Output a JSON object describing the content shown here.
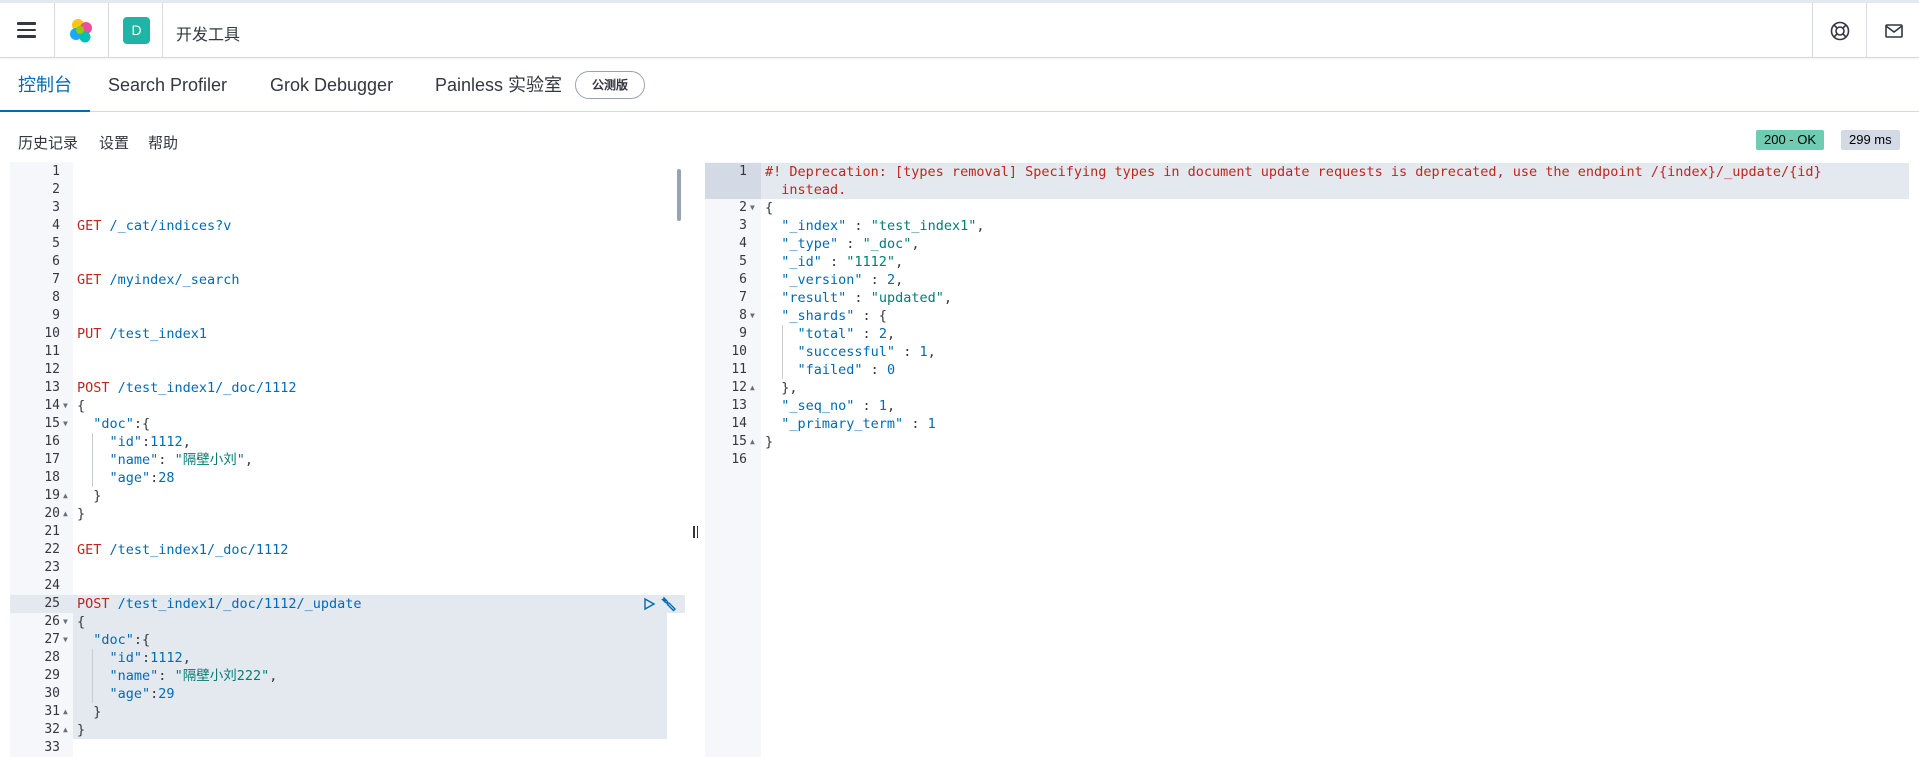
{
  "header": {
    "space_initial": "D",
    "app_title": "开发工具"
  },
  "tabs": [
    {
      "label": "控制台",
      "active": true
    },
    {
      "label": "Search Profiler",
      "active": false
    },
    {
      "label": "Grok Debugger",
      "active": false
    },
    {
      "label": "Painless 实验室",
      "active": false
    }
  ],
  "beta_badge": "公测版",
  "subnav": {
    "history": "历史记录",
    "settings": "设置",
    "help": "帮助"
  },
  "status": {
    "code": "200 - OK",
    "time": "299 ms"
  },
  "request_lines": [
    {
      "n": "1",
      "tokens": []
    },
    {
      "n": "2",
      "tokens": []
    },
    {
      "n": "3",
      "tokens": []
    },
    {
      "n": "4",
      "tokens": [
        {
          "t": "GET",
          "c": "m-get"
        },
        {
          "t": " /_cat/indices?v",
          "c": "url"
        }
      ]
    },
    {
      "n": "5",
      "tokens": []
    },
    {
      "n": "6",
      "tokens": []
    },
    {
      "n": "7",
      "tokens": [
        {
          "t": "GET",
          "c": "m-get"
        },
        {
          "t": " /myindex/_search",
          "c": "url"
        }
      ]
    },
    {
      "n": "8",
      "tokens": []
    },
    {
      "n": "9",
      "tokens": []
    },
    {
      "n": "10",
      "tokens": [
        {
          "t": "PUT",
          "c": "m-put"
        },
        {
          "t": " /test_index1",
          "c": "url"
        }
      ]
    },
    {
      "n": "11",
      "tokens": []
    },
    {
      "n": "12",
      "tokens": []
    },
    {
      "n": "13",
      "tokens": [
        {
          "t": "POST",
          "c": "m-post"
        },
        {
          "t": " /test_index1/_doc/1112",
          "c": "url"
        }
      ]
    },
    {
      "n": "14",
      "fold": "▼",
      "tokens": [
        {
          "t": "{",
          "c": ""
        }
      ]
    },
    {
      "n": "15",
      "fold": "▼",
      "tokens": [
        {
          "t": "  ",
          "c": ""
        },
        {
          "t": "\"doc\"",
          "c": "key"
        },
        {
          "t": ":{",
          "c": ""
        }
      ]
    },
    {
      "n": "16",
      "tokens": [
        {
          "t": "    ",
          "c": ""
        },
        {
          "t": "\"id\"",
          "c": "key"
        },
        {
          "t": ":",
          "c": ""
        },
        {
          "t": "1112",
          "c": "num-v"
        },
        {
          "t": ",",
          "c": ""
        }
      ]
    },
    {
      "n": "17",
      "tokens": [
        {
          "t": "    ",
          "c": ""
        },
        {
          "t": "\"name\"",
          "c": "key"
        },
        {
          "t": ": ",
          "c": ""
        },
        {
          "t": "\"隔壁小刘\"",
          "c": "str"
        },
        {
          "t": ",",
          "c": ""
        }
      ]
    },
    {
      "n": "18",
      "tokens": [
        {
          "t": "    ",
          "c": ""
        },
        {
          "t": "\"age\"",
          "c": "key"
        },
        {
          "t": ":",
          "c": ""
        },
        {
          "t": "28",
          "c": "num-v"
        }
      ]
    },
    {
      "n": "19",
      "fold": "▲",
      "tokens": [
        {
          "t": "  }",
          "c": ""
        }
      ]
    },
    {
      "n": "20",
      "fold": "▲",
      "tokens": [
        {
          "t": "}",
          "c": ""
        }
      ]
    },
    {
      "n": "21",
      "tokens": []
    },
    {
      "n": "22",
      "tokens": [
        {
          "t": "GET",
          "c": "m-get"
        },
        {
          "t": " /test_index1/_doc/1112",
          "c": "url"
        }
      ]
    },
    {
      "n": "23",
      "tokens": []
    },
    {
      "n": "24",
      "tokens": []
    },
    {
      "n": "25",
      "hl": true,
      "tokens": [
        {
          "t": "POST",
          "c": "m-post"
        },
        {
          "t": " /test_index1/_doc/1112/_update",
          "c": "url"
        }
      ]
    },
    {
      "n": "26",
      "sel": true,
      "fold": "▼",
      "tokens": [
        {
          "t": "{",
          "c": ""
        }
      ]
    },
    {
      "n": "27",
      "sel": true,
      "fold": "▼",
      "tokens": [
        {
          "t": "  ",
          "c": ""
        },
        {
          "t": "\"doc\"",
          "c": "key"
        },
        {
          "t": ":{",
          "c": ""
        }
      ]
    },
    {
      "n": "28",
      "sel": true,
      "tokens": [
        {
          "t": "    ",
          "c": ""
        },
        {
          "t": "\"id\"",
          "c": "key"
        },
        {
          "t": ":",
          "c": ""
        },
        {
          "t": "1112",
          "c": "num-v"
        },
        {
          "t": ",",
          "c": ""
        }
      ]
    },
    {
      "n": "29",
      "sel": true,
      "tokens": [
        {
          "t": "    ",
          "c": ""
        },
        {
          "t": "\"name\"",
          "c": "key"
        },
        {
          "t": ": ",
          "c": ""
        },
        {
          "t": "\"隔壁小刘222\"",
          "c": "str"
        },
        {
          "t": ",",
          "c": ""
        }
      ]
    },
    {
      "n": "30",
      "sel": true,
      "tokens": [
        {
          "t": "    ",
          "c": ""
        },
        {
          "t": "\"age\"",
          "c": "key"
        },
        {
          "t": ":",
          "c": ""
        },
        {
          "t": "29",
          "c": "num-v"
        }
      ]
    },
    {
      "n": "31",
      "sel": true,
      "fold": "▲",
      "tokens": [
        {
          "t": "  }",
          "c": ""
        }
      ]
    },
    {
      "n": "32",
      "sel": true,
      "fold": "▲",
      "tokens": [
        {
          "t": "}",
          "c": ""
        }
      ]
    },
    {
      "n": "33",
      "tokens": []
    }
  ],
  "response_lines": [
    {
      "n": "1",
      "hl": true,
      "tokens": [
        {
          "t": "#! Deprecation: [types removal] Specifying types in document update requests is deprecated, use the endpoint /{index}/_update/{id}",
          "c": "comment"
        }
      ]
    },
    {
      "n": "",
      "hl2": true,
      "tokens": [
        {
          "t": "  instead.",
          "c": "comment"
        }
      ]
    },
    {
      "n": "2",
      "fold": "▼",
      "tokens": [
        {
          "t": "{",
          "c": ""
        }
      ]
    },
    {
      "n": "3",
      "tokens": [
        {
          "t": "  ",
          "c": ""
        },
        {
          "t": "\"_index\"",
          "c": "rkey"
        },
        {
          "t": " : ",
          "c": ""
        },
        {
          "t": "\"test_index1\"",
          "c": "rstr"
        },
        {
          "t": ",",
          "c": ""
        }
      ]
    },
    {
      "n": "4",
      "tokens": [
        {
          "t": "  ",
          "c": ""
        },
        {
          "t": "\"_type\"",
          "c": "rkey"
        },
        {
          "t": " : ",
          "c": ""
        },
        {
          "t": "\"_doc\"",
          "c": "rstr"
        },
        {
          "t": ",",
          "c": ""
        }
      ]
    },
    {
      "n": "5",
      "tokens": [
        {
          "t": "  ",
          "c": ""
        },
        {
          "t": "\"_id\"",
          "c": "rkey"
        },
        {
          "t": " : ",
          "c": ""
        },
        {
          "t": "\"1112\"",
          "c": "rstr"
        },
        {
          "t": ",",
          "c": ""
        }
      ]
    },
    {
      "n": "6",
      "tokens": [
        {
          "t": "  ",
          "c": ""
        },
        {
          "t": "\"_version\"",
          "c": "rkey"
        },
        {
          "t": " : ",
          "c": ""
        },
        {
          "t": "2",
          "c": "rnum"
        },
        {
          "t": ",",
          "c": ""
        }
      ]
    },
    {
      "n": "7",
      "tokens": [
        {
          "t": "  ",
          "c": ""
        },
        {
          "t": "\"result\"",
          "c": "rkey"
        },
        {
          "t": " : ",
          "c": ""
        },
        {
          "t": "\"updated\"",
          "c": "rstr"
        },
        {
          "t": ",",
          "c": ""
        }
      ]
    },
    {
      "n": "8",
      "fold": "▼",
      "tokens": [
        {
          "t": "  ",
          "c": ""
        },
        {
          "t": "\"_shards\"",
          "c": "rkey"
        },
        {
          "t": " : {",
          "c": ""
        }
      ]
    },
    {
      "n": "9",
      "tokens": [
        {
          "t": "    ",
          "c": ""
        },
        {
          "t": "\"total\"",
          "c": "rkey"
        },
        {
          "t": " : ",
          "c": ""
        },
        {
          "t": "2",
          "c": "rnum"
        },
        {
          "t": ",",
          "c": ""
        }
      ]
    },
    {
      "n": "10",
      "tokens": [
        {
          "t": "    ",
          "c": ""
        },
        {
          "t": "\"successful\"",
          "c": "rkey"
        },
        {
          "t": " : ",
          "c": ""
        },
        {
          "t": "1",
          "c": "rnum"
        },
        {
          "t": ",",
          "c": ""
        }
      ]
    },
    {
      "n": "11",
      "tokens": [
        {
          "t": "    ",
          "c": ""
        },
        {
          "t": "\"failed\"",
          "c": "rkey"
        },
        {
          "t": " : ",
          "c": ""
        },
        {
          "t": "0",
          "c": "rnum"
        }
      ]
    },
    {
      "n": "12",
      "fold": "▲",
      "tokens": [
        {
          "t": "  },",
          "c": ""
        }
      ]
    },
    {
      "n": "13",
      "tokens": [
        {
          "t": "  ",
          "c": ""
        },
        {
          "t": "\"_seq_no\"",
          "c": "rkey"
        },
        {
          "t": " : ",
          "c": ""
        },
        {
          "t": "1",
          "c": "rnum"
        },
        {
          "t": ",",
          "c": ""
        }
      ]
    },
    {
      "n": "14",
      "tokens": [
        {
          "t": "  ",
          "c": ""
        },
        {
          "t": "\"_primary_term\"",
          "c": "rkey"
        },
        {
          "t": " : ",
          "c": ""
        },
        {
          "t": "1",
          "c": "rnum"
        }
      ]
    },
    {
      "n": "15",
      "fold": "▲",
      "tokens": [
        {
          "t": "}",
          "c": ""
        }
      ]
    },
    {
      "n": "16",
      "tokens": []
    }
  ],
  "icons": {
    "menu": "hamburger-menu-icon",
    "logo": "elastic-logo-icon",
    "help": "help-lifebuoy-icon",
    "mail": "mail-icon",
    "play": "play-icon",
    "wrench": "wrench-icon"
  },
  "colors": {
    "accent": "#006bb4",
    "method": "#bd271e",
    "string": "#017d73",
    "ok_badge": "#6dccb1"
  }
}
